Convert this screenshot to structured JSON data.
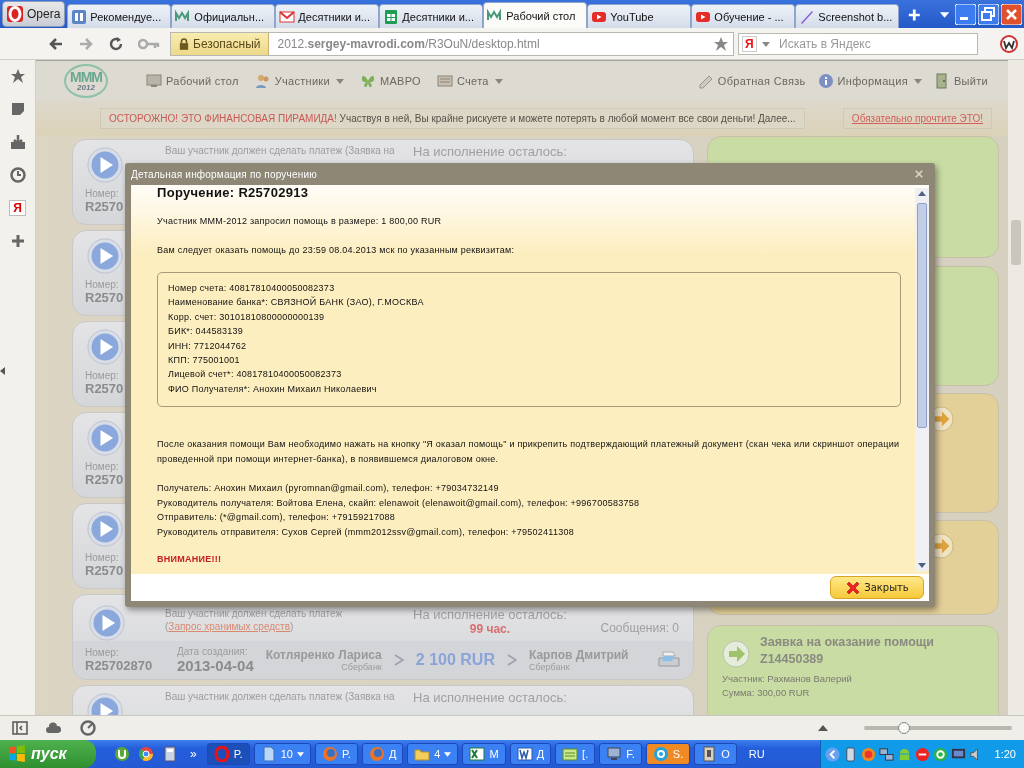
{
  "browser": {
    "opera_button": "Opera",
    "tabs": [
      {
        "kind": "panel",
        "title": "Рекомендуе...",
        "selected": false
      },
      {
        "kind": "mmm",
        "title": "Официальн...",
        "selected": false
      },
      {
        "kind": "mail",
        "title": "Десятники и...",
        "selected": false
      },
      {
        "kind": "sheet",
        "title": "Десятники и...",
        "selected": false
      },
      {
        "kind": "mmm",
        "title": "Рабочий стол",
        "selected": true
      },
      {
        "kind": "video",
        "title": "YouTube",
        "selected": false
      },
      {
        "kind": "video",
        "title": "Обучение - ...",
        "selected": false
      },
      {
        "kind": "pen",
        "title": "Screenshot b...",
        "selected": false
      }
    ],
    "security": "Безопасный",
    "url": "2012.**sergey-mavrodi.com**/R3OuN/desktop.html",
    "search_logo": "Я",
    "search_placeholder": "Искать в Яндекс",
    "sidebar_yandex": "Я"
  },
  "site": {
    "logo_text": "MMM",
    "logo_year": "2012",
    "menu_left": [
      {
        "kind": "desktop",
        "label": "Рабочий стол",
        "dropdown": false
      },
      {
        "kind": "people",
        "label": "Участники",
        "dropdown": true
      },
      {
        "kind": "butterfly",
        "label": "МАВРО",
        "dropdown": false
      },
      {
        "kind": "accounts",
        "label": "Счета",
        "dropdown": true
      }
    ],
    "menu_right": [
      {
        "kind": "feedback",
        "label": "Обратная Связь",
        "dropdown": false
      },
      {
        "kind": "info",
        "label": "Информация",
        "dropdown": true
      },
      {
        "kind": "exit",
        "label": "Выйти",
        "dropdown": false
      }
    ],
    "warning": {
      "alert": "ОСТОРОЖНО! ЭТО ФИНАНСОВАЯ ПИРАМИДА!",
      "text": "Участвуя в ней, Вы крайне рискуете и можете потерять в любой момент все свои деньги! Далее...",
      "link": "Обязательно прочтите ЭТО!"
    }
  },
  "orders": [
    {
      "kind": "covered",
      "message": "Ваш участник должен сделать платеж (Заявка на",
      "remaining": "На исполнение осталось:",
      "number_label": "Номер:",
      "number": "R2570"
    },
    {
      "kind": "covered",
      "number_label": "Номер:",
      "number": "R2570"
    },
    {
      "kind": "covered",
      "number_label": "Номер:",
      "number": "R2570"
    },
    {
      "kind": "covered",
      "number_label": "Номер:",
      "number": "R2570"
    },
    {
      "kind": "covered",
      "number_label": "Номер:",
      "number": "R2570"
    },
    {
      "kind": "full",
      "message": "Ваш участник должен сделать платеж (",
      "message_link": "Запрос хранимых средств",
      "message_end": ")",
      "remaining": "На исполнение осталось:",
      "hours": "99 час.",
      "messages": "Сообщения: 0",
      "number_label": "Номер:",
      "number": "R25702870",
      "date_label": "Дата создания:",
      "date": "2013-04-04",
      "sender": "Котляренко Лариса",
      "sender_bank": "Сбербанк",
      "amount": "2 100 RUR",
      "receiver": "Карпов Дмитрий",
      "receiver_bank": "Сбербанк"
    },
    {
      "kind": "cut",
      "message": "Ваш участник должен сделать платеж (Заявка на",
      "remaining": "На исполнение осталось:"
    }
  ],
  "right_cards": [
    {
      "color": "#c9dca4"
    },
    {
      "color": "#c9dca4"
    },
    {
      "color": "#e3cf98",
      "arrow": true
    },
    {
      "color": "#e3cf98",
      "arrow": true
    },
    {
      "color": "#c9dca4",
      "title": "Заявка на оказание помощи",
      "number": "Z14450389",
      "lines": [
        "Участник: Рахманов Валерий",
        "Сумма: 300,00 RUR"
      ]
    }
  ],
  "modal": {
    "title": "Детальная информация по поручению",
    "heading": "Поручение: R25702913",
    "intro": "Участник MMM-2012 запросил помощь в размере: 1 800,00 RUR",
    "deadline": "Вам следует оказать помощь до 23:59 08.04.2013 мск по указанным реквизитам:",
    "details": [
      "Номер счета: 40817810400050082373",
      "Наименование банка*: СВЯЗНОЙ БАНК (ЗАО), Г.МОСКВА",
      "Корр. счет: 30101810800000000139",
      "БИК*: 044583139",
      "ИНН: 7712044762",
      "КПП: 775001001",
      "Лицевой счет*: 40817810400050082373",
      "ФИО Получателя*: Анохин Михаил Николаевич"
    ],
    "instructions": "После оказания помощи Вам необходимо нажать на кнопку \"Я оказал помощь\" и прикрепить подтверждающий платежный документ (скан чека или скриншот операции проведенной при помощи интернет-банка), в появившемся диалоговом окне.",
    "contacts": [
      "Получатель: Анохин Михаил (pyromnan@gmail.com), телефон: +79034732149",
      "Руководитель получателя: Войтова Елена, скайп: elenawoit (elenawoit@gmail.com), телефон: +996700583758",
      "Отправитель: (*@gmail.com), телефон: +79159217088",
      "Руководитель отправителя: Сухов Сергей (mmm2012ssv@gmail.com), телефон: +79502411308"
    ],
    "warning": "ВНИМАНИЕ!!!",
    "close_button": "Закрыть"
  },
  "status": {
    "zoom": {
      "level": 0.27
    }
  },
  "taskbar": {
    "start": "пуск",
    "more": "»",
    "tasks": [
      {
        "kind": "opera",
        "label": "P.",
        "dropdown": false,
        "selected": true,
        "highlighted": false
      },
      {
        "kind": "doc",
        "label": "10",
        "dropdown": true,
        "selected": false,
        "highlighted": false
      },
      {
        "kind": "firefox",
        "label": "P.",
        "dropdown": false,
        "selected": false,
        "highlighted": false
      },
      {
        "kind": "firefox",
        "label": "Д",
        "dropdown": false,
        "selected": false,
        "highlighted": false
      },
      {
        "kind": "folder",
        "label": "4",
        "dropdown": true,
        "selected": false,
        "highlighted": false
      },
      {
        "kind": "excel",
        "label": "M",
        "dropdown": false,
        "selected": false,
        "highlighted": false
      },
      {
        "kind": "word",
        "label": "Д",
        "dropdown": false,
        "selected": false,
        "highlighted": false
      },
      {
        "kind": "sheet",
        "label": "[.",
        "dropdown": false,
        "selected": false,
        "highlighted": false
      },
      {
        "kind": "computer",
        "label": "F.",
        "dropdown": false,
        "selected": false,
        "highlighted": false
      },
      {
        "kind": "skype",
        "label": "S.",
        "dropdown": false,
        "selected": false,
        "highlighted": true
      },
      {
        "kind": "book",
        "label": "O",
        "dropdown": false,
        "selected": false,
        "highlighted": false
      }
    ],
    "lang": "RU",
    "clock": "1:20"
  }
}
